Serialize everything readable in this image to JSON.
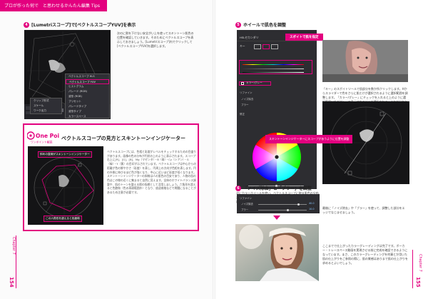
{
  "header": {
    "text": "プロが作った何で　と思わせるかんたん編集 Tips"
  },
  "left_page": {
    "step_number": "4",
    "step_title": "[Lumetriスコープ]で[ベクトルスコープYUV]を表示",
    "body_text": "次のに割を下けない安全がい上を使ってスキントーン肌色の位置を確認していきます。そのためにベクトルスコープを表示しておきましょう。[Lumetriスコープ]内でクリックして[ベクトルスコープYUV]を選択します。",
    "menu_items": [
      "ベクトルスコープ HLS",
      "ベクトルスコープ YUV",
      "ヒストグラム",
      "パレード (RGB)",
      "波形 (RGB)",
      "プリセット",
      "パレードタイプ",
      "波形タイプ",
      "カラースペース"
    ],
    "menu_small": [
      "クリップ形式",
      "スケール",
      "ワーク出力"
    ],
    "onepoint": {
      "logo_main": "One Point",
      "logo_sub": "ワンポイント解説",
      "title": "ベクトルスコープの見方とスキントーンインジケーター",
      "label_top": "斜めの直線がスキントーンインジケーター",
      "label_bottom": "この六角形を超えると色飽和",
      "body": "ベクトルスコープには、色相と彩度がレベルをチェックするための目盛りがあります。画像の色の分布が円状の上のように表示されます。スコープ右上に[R]、[G]、[B]、Mg（マゼンタ）・B（青）・Cy（シアン）・G（緑）・Y（黄）の目印が示されています。ベクトルスコープは中心からの距離が色の鮮やかさ（彩度）を表し、円周上の方向が色相を表します。円の外側に伸びるほど色が強くなり、中心に近いほど彩度が低くなります。スキントーンインジケーターの斜線は人の肌色の目安であり、人物の肌の色はこの線の近くに集まると自然に見えます。全体のホワイトバランス調整や、肌のトーンを整える際の指標として活用しましょう。六角形を超えると色飽和（色の再現範囲外）となり、放送規格などで問題になることがあるため注意が必要です。"
    },
    "page_label": "Chapter 7",
    "page_number": "154"
  },
  "right_page": {
    "step5_number": "5",
    "step5_title": "ホイールで肌色を調整",
    "eyedropper_label": "スポイトで肌を指定",
    "panel_labels": [
      "カーブ",
      "HSLセカンダリ",
      "キー",
      "設定",
      "スキントーン",
      "カラー/グレー",
      "リファイン",
      "ノイズ除去",
      "ブラー",
      "修正"
    ],
    "step5_body": "「キー」のスポイトツールで肌部分を数か所クリックします。Hからスライダーで色をさらに肌だけが選択されるように選択範囲を調整します。「カラー/グレー」にチェックを入れると上のように選択範囲以外がグレーで表示されてどこが選択されているかが分かりやすくなります。",
    "wheel_callout": "スキントーンインジケーターにスコープがあうように位置を調整",
    "wheel_body": "次にカラーホイールを使い、ベクトルスコープに映る肌色の分布がこの六角形のラインとスキントーンインジケーターの合うように位置を調整します。",
    "step6_number": "6",
    "step6_title": "「ノイズ除去」と「ブラー」を調整",
    "step6_rows": [
      "リファイン",
      "ノイズ除去",
      "ブラー"
    ],
    "step6_values": [
      "40.0",
      "10.0"
    ],
    "step6_body": "最後に「ノイズ除去」や「ブラー」を使って、調整した部分をエッジでなじませましょう。",
    "final_body": "ここまでで仕上がったカラーグレーディングは完了です。ボーカー・トレースペース動画を実現させる前に完成を確認できるようになっています。まさ、このカラーグレーディングを何事とか用いた肌の仕上がりをご参照の際に、肌の質感はありまで肌の仕上がりを求めるとよいでしょう。",
    "page_label": "Chapter 7",
    "page_number": "155"
  },
  "colors": {
    "accent": "#e3007f",
    "dark_ui": "#1c1c1f",
    "panel": "#2d2d31"
  }
}
